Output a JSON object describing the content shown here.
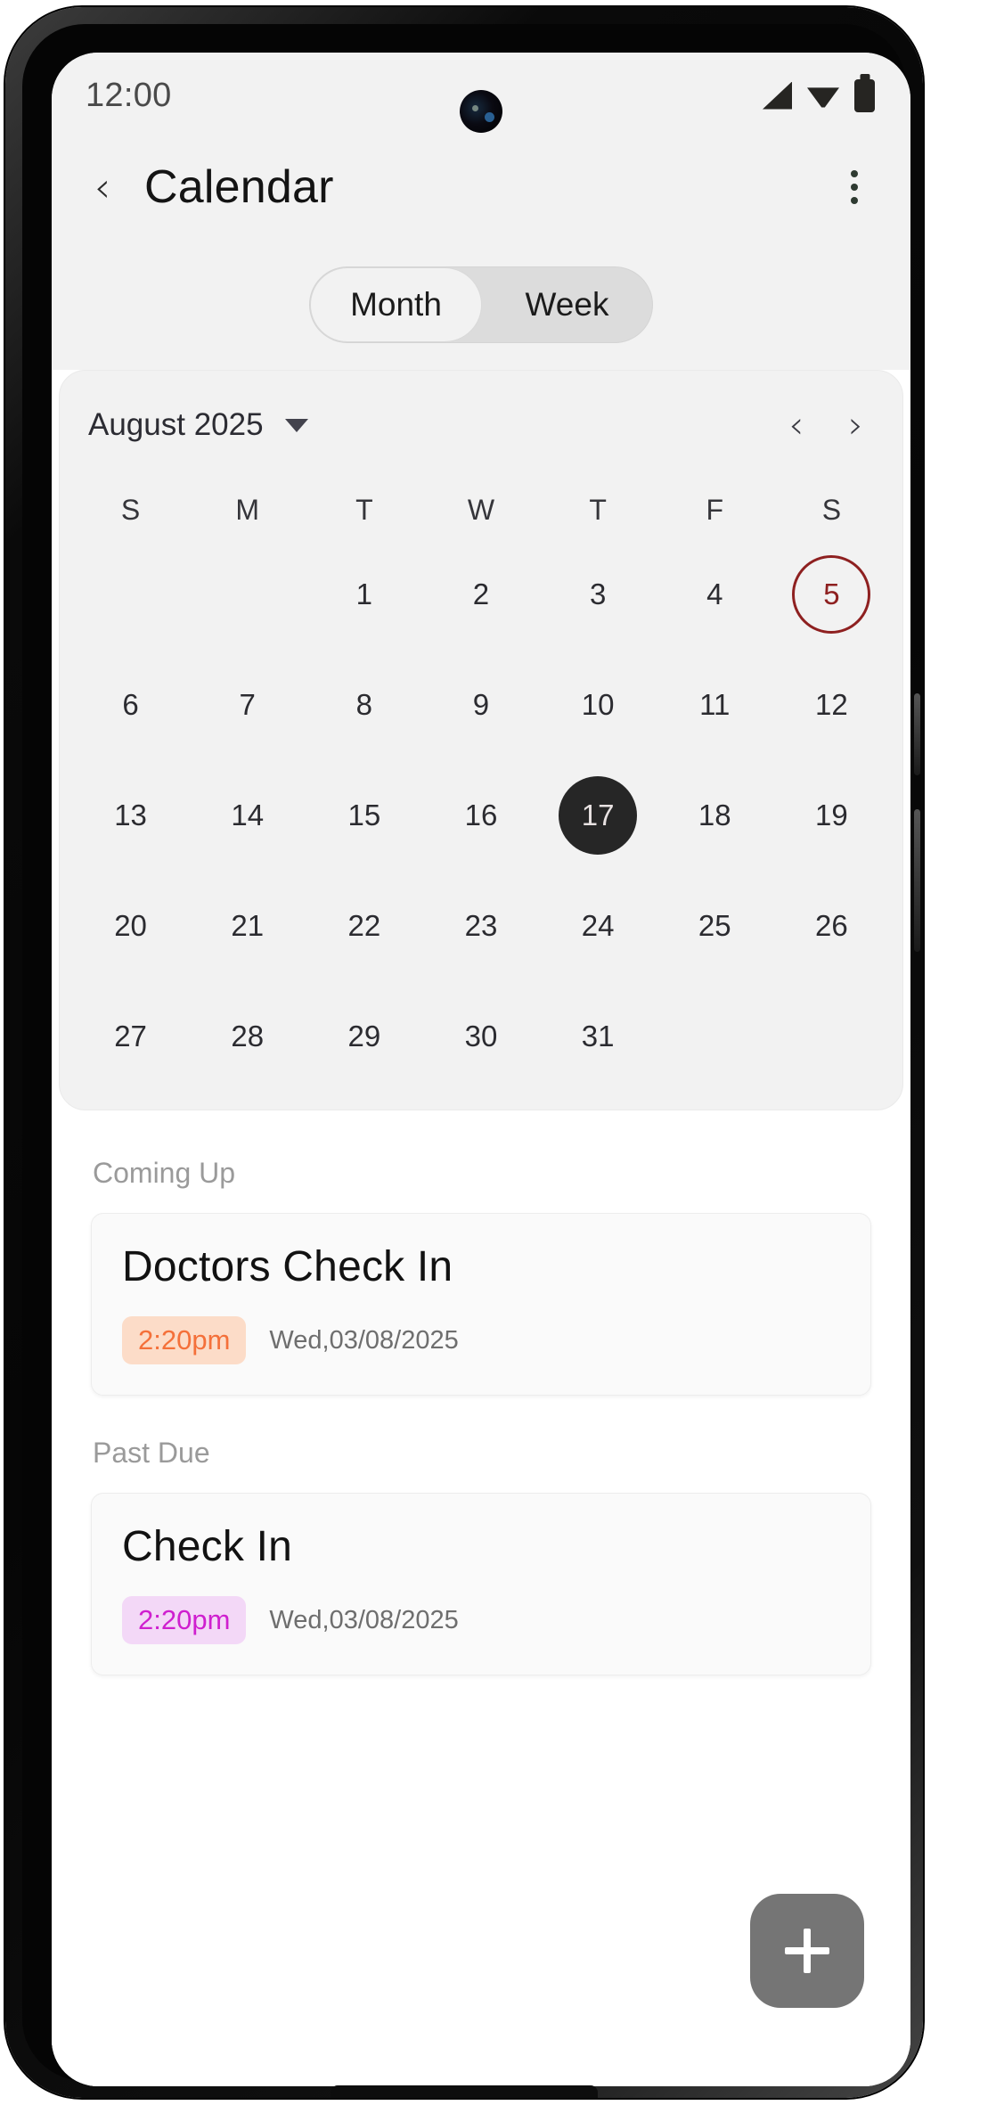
{
  "status_bar": {
    "time": "12:00",
    "icons": [
      "signal-icon",
      "wifi-icon",
      "battery-icon"
    ]
  },
  "app_bar": {
    "back_icon": "chevron-left-icon",
    "title": "Calendar",
    "menu_icon": "kebab-menu-icon"
  },
  "view_toggle": {
    "options": [
      {
        "label": "Month",
        "selected": true
      },
      {
        "label": "Week",
        "selected": false
      }
    ]
  },
  "calendar": {
    "month_label": "August 2025",
    "caret_icon": "chevron-down-icon",
    "prev_icon": "chevron-left-icon",
    "next_icon": "chevron-right-icon",
    "weekdays": [
      "S",
      "M",
      "T",
      "W",
      "T",
      "F",
      "S"
    ],
    "today": 5,
    "selected": 17,
    "colors": {
      "today_ring": "#8e2020",
      "selected_fill": "#262626",
      "selected_text": "#e8e2e2"
    },
    "weeks": [
      [
        "",
        "",
        "1",
        "2",
        "3",
        "4",
        "5"
      ],
      [
        "6",
        "7",
        "8",
        "9",
        "10",
        "11",
        "12"
      ],
      [
        "13",
        "14",
        "15",
        "16",
        "17",
        "18",
        "19"
      ],
      [
        "20",
        "21",
        "22",
        "23",
        "24",
        "25",
        "26"
      ],
      [
        "27",
        "28",
        "29",
        "30",
        "31",
        "",
        ""
      ]
    ]
  },
  "sections": [
    {
      "title": "Coming Up",
      "event": {
        "title": "Doctors Check In",
        "time": "2:20pm",
        "date": "Wed,03/08/2025",
        "badge_bg": "#fcdcc8",
        "badge_text": "#f4703a"
      }
    },
    {
      "title": "Past Due",
      "event": {
        "title": "Check In",
        "time": "2:20pm",
        "date": "Wed,03/08/2025",
        "badge_bg": "#f3d8f7",
        "badge_text": "#cf20cf"
      }
    }
  ],
  "fab": {
    "icon": "plus-icon",
    "color": "#757575"
  }
}
